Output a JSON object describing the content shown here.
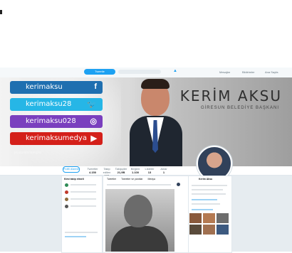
{
  "topbar": {
    "tweet_button": "Tweetle",
    "nav_left": [
      "Ana Sayfa",
      "Bildirimler",
      "Mesajlar"
    ]
  },
  "cover": {
    "name": "KERİM AKSU",
    "title": "GİRESUN BELEDİYE BAŞKANI",
    "social": [
      {
        "label": "kerimaksu",
        "glyph": "f",
        "icon": "facebook-icon",
        "color": "#1f6fb0"
      },
      {
        "label": "kerimaksu28",
        "glyph": "🐦",
        "icon": "twitter-icon",
        "color": "#26b6e6"
      },
      {
        "label": "kerimaksu028",
        "glyph": "◎",
        "icon": "instagram-icon",
        "color": "#7a3fbe"
      },
      {
        "label": "kerimaksumedya",
        "glyph": "▶",
        "icon": "youtube-icon",
        "color": "#d4201a"
      }
    ],
    "reflection": "kerimaksumedya"
  },
  "stats": [
    {
      "label": "Tweetler",
      "value": "4.150"
    },
    {
      "label": "Takip edilen",
      "value": "120"
    },
    {
      "label": "Takipçiler",
      "value": "21,9B"
    },
    {
      "label": "Beğeni",
      "value": "1.100"
    },
    {
      "label": "Listeler",
      "value": "13"
    },
    {
      "label": "Anlar",
      "value": "1"
    }
  ],
  "follow_button": "Profili düzenle",
  "feed": {
    "tabs": [
      "Tweetler",
      "Tweetler ve yanıtlar",
      "Medya"
    ]
  },
  "who_to_follow": {
    "title": "Kimi takip etmeli"
  },
  "profile": {
    "name": "Kerim Aksu"
  }
}
